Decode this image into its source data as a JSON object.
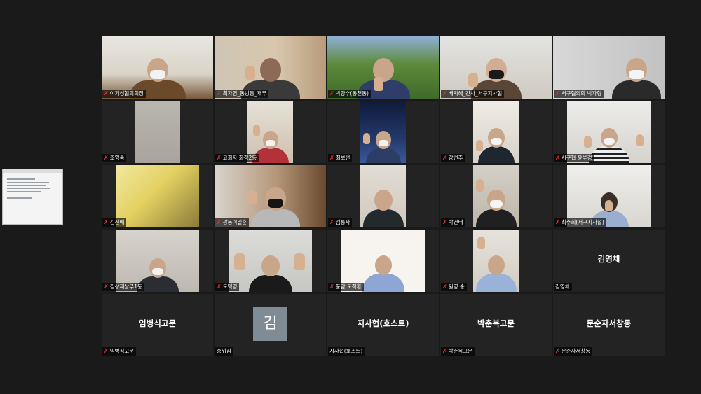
{
  "shared_screen": {
    "label": ""
  },
  "participants": [
    {
      "name": "이기성협의회장",
      "muted": true,
      "video": true,
      "active": true
    },
    {
      "name": "최자영_동방동_재무",
      "muted": true,
      "video": true
    },
    {
      "name": "박양수(동천동)",
      "muted": true,
      "video": true
    },
    {
      "name": "배지혜_간사_서구지사협",
      "muted": true,
      "video": true
    },
    {
      "name": "서구협의회 박자형",
      "muted": true,
      "video": true
    },
    {
      "name": "조영숙",
      "muted": true,
      "video": true
    },
    {
      "name": "고회자 화정2동",
      "muted": true,
      "video": true
    },
    {
      "name": "최보선",
      "muted": true,
      "video": true
    },
    {
      "name": "강선주",
      "muted": true,
      "video": true
    },
    {
      "name": "서구협 윤부경",
      "muted": true,
      "video": true
    },
    {
      "name": "김신배",
      "muted": true,
      "video": true
    },
    {
      "name": "광동이일훈",
      "muted": true,
      "video": true
    },
    {
      "name": "김통자",
      "muted": true,
      "video": true
    },
    {
      "name": "박건태",
      "muted": true,
      "video": true
    },
    {
      "name": "최주희(서구지사협)",
      "muted": true,
      "video": true
    },
    {
      "name": "김상재상무1동",
      "muted": true,
      "video": true
    },
    {
      "name": "도덕영",
      "muted": true,
      "video": true
    },
    {
      "name": "풍암 도적환",
      "muted": true,
      "video": true
    },
    {
      "name": "원영 송",
      "muted": true,
      "video": true
    },
    {
      "name": "김영채",
      "muted": false,
      "video": false,
      "display_name": "김영채"
    },
    {
      "name": "임병식고문",
      "muted": true,
      "video": false,
      "display_name": "임병식고문"
    },
    {
      "name": "송위김",
      "muted": false,
      "video": false,
      "avatar": "김"
    },
    {
      "name": "지사협(호스트)",
      "muted": false,
      "video": false,
      "display_name": "지사협(호스트)"
    },
    {
      "name": "박춘복고문",
      "muted": true,
      "video": false,
      "display_name": "박춘복고문"
    },
    {
      "name": "문순자서창동",
      "muted": true,
      "video": false,
      "display_name": "문순자서창동"
    }
  ],
  "icons": {
    "mic_muted": "mic-muted-icon"
  },
  "colors": {
    "background": "#1a1a1a",
    "tile": "#232323",
    "active_border": "#c8d44a",
    "muted_mic": "#e0363a",
    "avatar": "#7f8c95"
  }
}
